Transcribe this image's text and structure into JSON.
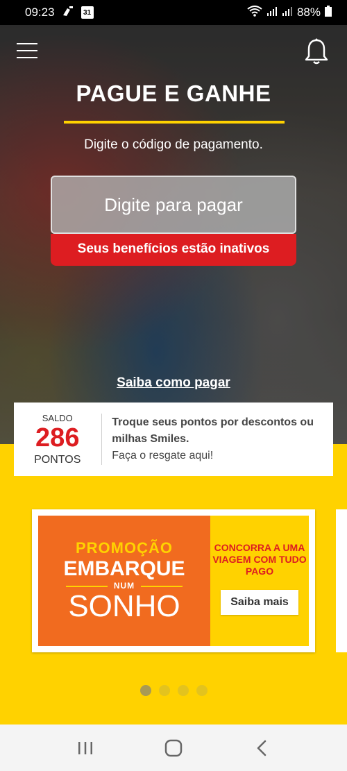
{
  "status_bar": {
    "time": "09:23",
    "calendar_day": "31",
    "battery": "88%"
  },
  "header": {
    "title": "PAGUE E GANHE",
    "subtitle": "Digite o código de pagamento."
  },
  "payment": {
    "placeholder": "Digite para pagar",
    "inactive_notice": "Seus benefícios estão inativos",
    "how_to_link": "Saiba como pagar"
  },
  "points": {
    "saldo_label": "SALDO",
    "value": "286",
    "unit": "PONTOS",
    "description_bold": "Troque seus pontos por descontos ou milhas Smiles.",
    "description_link": "Faça o resgate aqui!"
  },
  "promo": {
    "line1": "PROMOÇÃO",
    "line2": "EMBARQUE",
    "line3": "NUM",
    "line4": "SONHO",
    "side_text": "CONCORRA A UMA VIAGEM COM TUDO PAGO",
    "button": "Saiba mais"
  },
  "carousel": {
    "total": 4,
    "active": 1
  },
  "colors": {
    "brand_yellow": "#ffd200",
    "brand_red": "#dd1d21",
    "promo_orange": "#f16b1f"
  },
  "icons": {
    "menu": "hamburger-menu-icon",
    "notifications": "bell-icon",
    "nav_recents": "recents-icon",
    "nav_home": "home-icon",
    "nav_back": "back-icon"
  }
}
